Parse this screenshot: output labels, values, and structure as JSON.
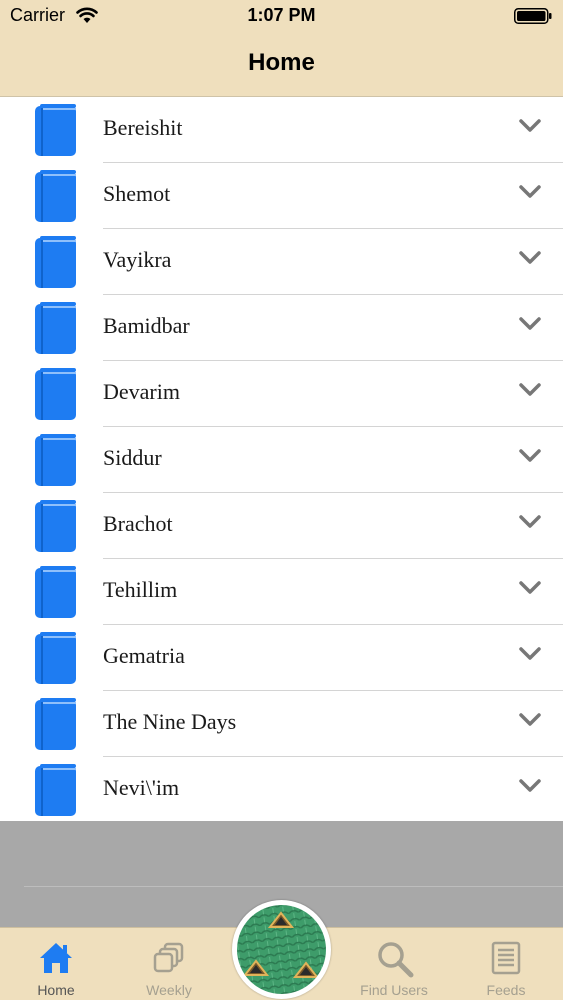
{
  "status_bar": {
    "carrier": "Carrier",
    "time": "1:07 PM"
  },
  "nav": {
    "title": "Home"
  },
  "books": [
    {
      "label": "Bereishit"
    },
    {
      "label": "Shemot"
    },
    {
      "label": "Vayikra"
    },
    {
      "label": "Bamidbar"
    },
    {
      "label": "Devarim"
    },
    {
      "label": "Siddur"
    },
    {
      "label": "Brachot"
    },
    {
      "label": "Tehillim"
    },
    {
      "label": "Gematria"
    },
    {
      "label": "The Nine Days"
    },
    {
      "label": "Nevi\\'im"
    }
  ],
  "tabs": {
    "home": "Home",
    "weekly": "Weekly",
    "find_users": "Find Users",
    "feeds": "Feeds"
  },
  "icons": {
    "book": "book-icon",
    "chevron": "chevron-down-icon",
    "home": "house-icon",
    "weekly": "stacked-squares-icon",
    "find_users": "magnifier-icon",
    "feeds": "document-icon",
    "center": "green-roof-logo-icon"
  },
  "colors": {
    "header_bg": "#efdfbd",
    "accent_blue": "#1e7cf2",
    "tab_inactive": "#a5a090"
  }
}
